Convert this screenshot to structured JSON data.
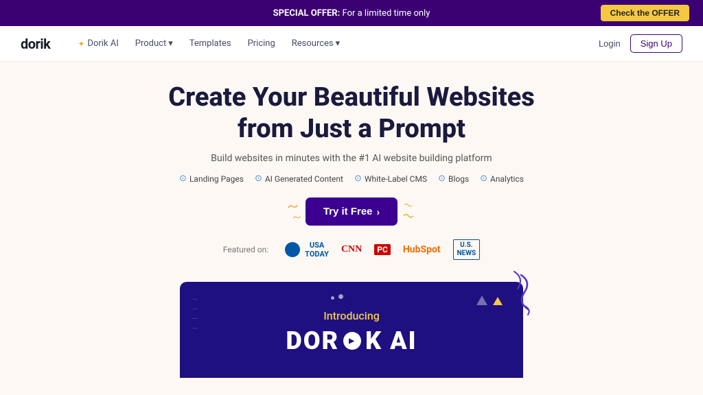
{
  "banner": {
    "offer_label": "SPECIAL OFFER:",
    "offer_text": " For a limited time only",
    "cta_label": "Check the OFFER"
  },
  "navbar": {
    "logo": "dorik",
    "nav_items": [
      {
        "label": "✦ Dorik AI",
        "has_dropdown": false,
        "id": "dorik-ai"
      },
      {
        "label": "Product",
        "has_dropdown": true,
        "id": "product"
      },
      {
        "label": "Templates",
        "has_dropdown": false,
        "id": "templates"
      },
      {
        "label": "Pricing",
        "has_dropdown": false,
        "id": "pricing"
      },
      {
        "label": "Resources",
        "has_dropdown": true,
        "id": "resources"
      }
    ],
    "login_label": "Login",
    "signup_label": "Sign Up"
  },
  "hero": {
    "title": "Create Your Beautiful Websites from Just a Prompt",
    "subtitle": "Build websites in minutes with the #1 AI website building platform",
    "features": [
      "Landing Pages",
      "AI Generated Content",
      "White-Label CMS",
      "Blogs",
      "Analytics"
    ],
    "cta_label": "Try it Free",
    "cta_arrow": "›"
  },
  "featured": {
    "label": "Featured on:",
    "logos": [
      {
        "name": "USA TODAY",
        "type": "usa-today"
      },
      {
        "name": "CNN",
        "type": "cnn"
      },
      {
        "name": "PC",
        "type": "pc"
      },
      {
        "name": "HubSpot",
        "type": "hubspot"
      },
      {
        "name": "U.S.NEWS",
        "type": "usnews"
      }
    ]
  },
  "preview": {
    "introducing": "Introducing",
    "brand_part1": "DOR",
    "brand_part2": "K AI"
  },
  "colors": {
    "brand_purple": "#3b0072",
    "banner_bg": "#3b0072",
    "cta_bg": "#3b0090",
    "hero_bg": "#fdf8f3"
  }
}
